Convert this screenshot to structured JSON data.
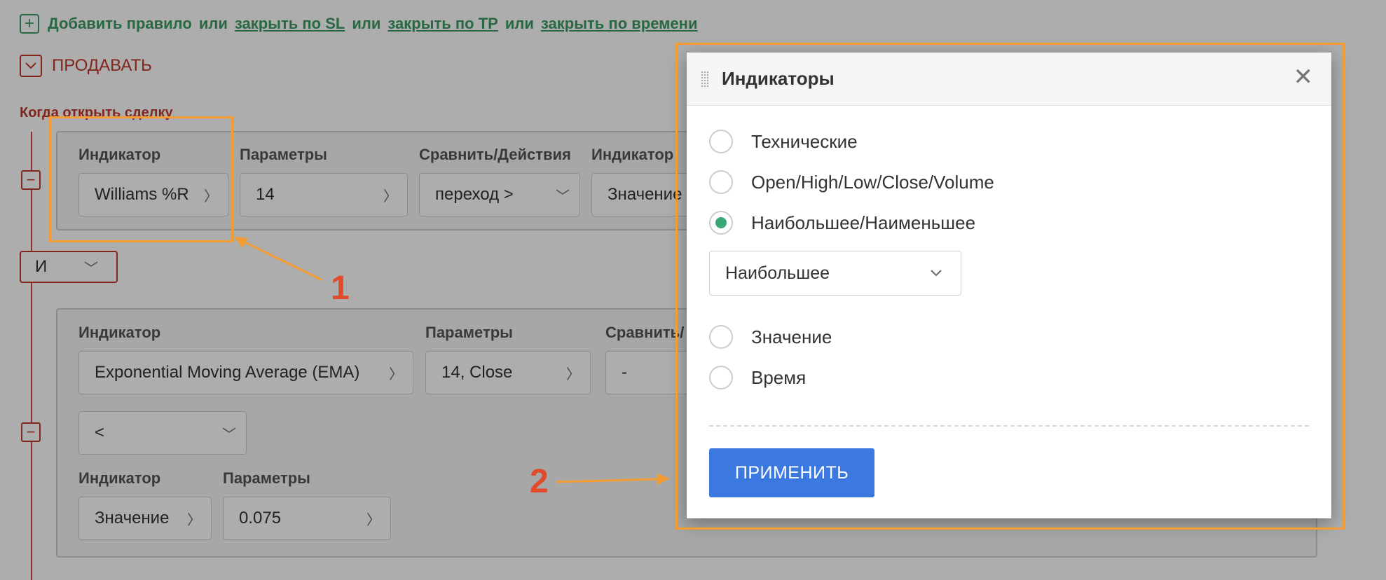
{
  "add_rule": {
    "text1": "Добавить правило",
    "or1": "или",
    "link_sl": "закрыть по SL",
    "or2": "или",
    "link_tp": "закрыть по TP",
    "or3": "или",
    "link_time": "закрыть по времени"
  },
  "sell": {
    "label": "ПРОДАВАТЬ"
  },
  "when_open": "Когда открыть сделку",
  "condition1": {
    "indicator_label": "Индикатор",
    "indicator_value": "Williams %R",
    "params_label": "Параметры",
    "params_value": "14",
    "compare_label": "Сравнить/Действия",
    "compare_value": "переход >",
    "indicator2_label": "Индикатор",
    "indicator2_value": "Значение"
  },
  "logic": {
    "value": "И"
  },
  "condition2": {
    "indicator_label": "Индикатор",
    "indicator_value": "Exponential Moving Average (EMA)",
    "params_label": "Параметры",
    "params_value": "14, Close",
    "compare_label": "Сравнить/",
    "compare_value": "-",
    "operator_value": "<",
    "indicator2_label": "Индикатор",
    "indicator2_value": "Значение",
    "params2_label": "Параметры",
    "params2_value": "0.075"
  },
  "modal": {
    "title": "Индикаторы",
    "options": [
      {
        "label": "Технические",
        "selected": false
      },
      {
        "label": "Open/High/Low/Close/Volume",
        "selected": false
      },
      {
        "label": "Наибольшее/Наименьшее",
        "selected": true
      },
      {
        "label": "Значение",
        "selected": false
      },
      {
        "label": "Время",
        "selected": false
      }
    ],
    "select_value": "Наибольшее",
    "apply_label": "ПРИМЕНИТЬ"
  },
  "annotations": {
    "num1": "1",
    "num2": "2"
  },
  "colors": {
    "accent_green": "#3aa876",
    "apply_blue": "#3b78e0",
    "annotation_orange": "#f39c34",
    "sell_red": "#c0392b"
  }
}
